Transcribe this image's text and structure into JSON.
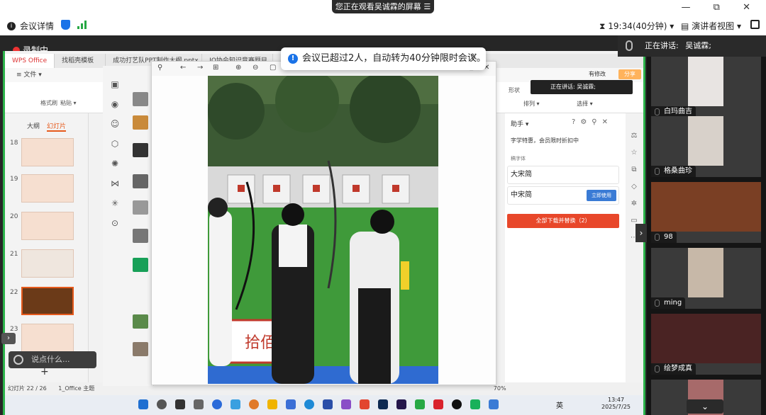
{
  "share_banner": {
    "label": "您正在观看吴诚霖的屏幕",
    "menu_glyph": "☰"
  },
  "window_controls": {
    "minimize": "—",
    "restore": "⧉",
    "close": "✕"
  },
  "meeting": {
    "info_label": "会议详情",
    "timer": "19:34(40分钟)",
    "view_mode": "演讲者视图",
    "recording": "录制中"
  },
  "toast": {
    "icon": "!",
    "message": "会议已超过2人，自动转为40分钟限时会议。",
    "close": "✕"
  },
  "speaker": {
    "label": "正在讲话:",
    "name": "吴诚霖;"
  },
  "participants": [
    {
      "name": "白玛曲吉",
      "skin": "#d9b8a5",
      "bg": "#e8e4e2"
    },
    {
      "name": "格桑曲珍",
      "skin": "#a77e63",
      "bg": "#d8d1ca"
    },
    {
      "name": "98",
      "skin": "#b97d5e",
      "bg": "#7a3f24"
    },
    {
      "name": "ming",
      "skin": "#eeeeee",
      "bg": "#c7b8a8"
    },
    {
      "name": "绘梦成真",
      "skin": "#8a4e37",
      "bg": "#4a2323"
    },
    {
      "name": "",
      "skin": "#e2c5c5",
      "bg": "#a76a6a"
    }
  ],
  "wps": {
    "tabs": [
      "WPS Office",
      "找稻壳模板",
      "成功打艺队PPT制作大纲.pptx",
      "IQ协会知识竞赛题目"
    ],
    "menu": "≡ 文件 ▾",
    "ribbon": {
      "format_painter": "格式刷",
      "paste": "粘贴 ▾",
      "arrange": "排列 ▾",
      "select": "选择 ▾",
      "layout_tab": "形状"
    },
    "panel_tabs": [
      "大纲",
      "幻灯片"
    ],
    "slides": [
      "18",
      "19",
      "20",
      "21",
      "22",
      "23"
    ],
    "assistant": {
      "title": "助手 ▾",
      "desc": "字学特惠，会员限时折扣中",
      "sub": "稿字体",
      "fonts": [
        "大宋简",
        "中宋简"
      ],
      "use_now": "立即使用",
      "download_all": "全部下载并替换（2）"
    },
    "modified": "有修改",
    "save": "分享",
    "mini_speaker": "正在讲话: 吴诚霖;",
    "status": {
      "page": "幻灯片 22 / 26",
      "theme": "1_Office 主题",
      "zoom": "70%"
    }
  },
  "comment": {
    "placeholder": "说点什么..."
  },
  "photo": {
    "sign_text": "拾佰"
  },
  "tray": {
    "ime": "英",
    "time": "13:47",
    "date": "2025/7/25"
  },
  "colors": {
    "accent_green": "#2cb24a",
    "wps_orange": "#e65a1c",
    "toast_blue": "#1a73e8"
  }
}
